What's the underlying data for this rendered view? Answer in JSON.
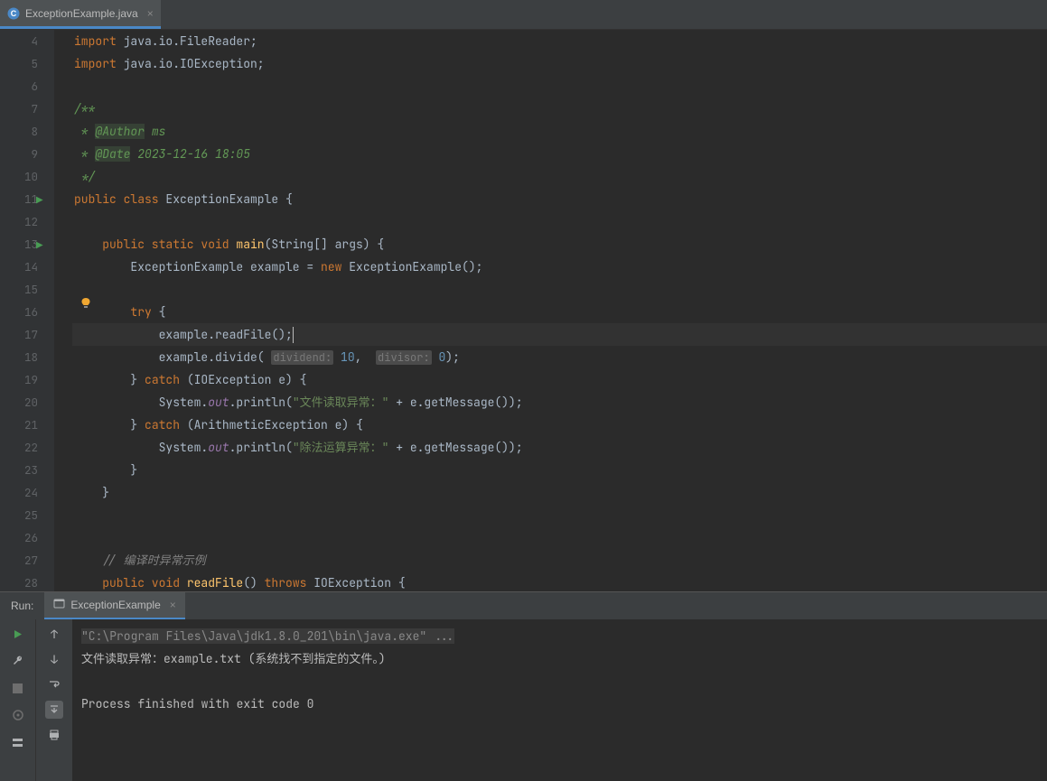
{
  "tab": {
    "filename": "ExceptionExample.java"
  },
  "gutter_start": 4,
  "gutter_end": 28,
  "run_markers": [
    11,
    13
  ],
  "bulb_line": 17,
  "code_lines": [
    {
      "n": 4,
      "html": "<span class='kw'>import </span>java.io.FileReader;"
    },
    {
      "n": 5,
      "html": "<span class='kw'>import </span>java.io.IOException;"
    },
    {
      "n": 6,
      "html": ""
    },
    {
      "n": 7,
      "html": "<span class='doc'>/**</span>"
    },
    {
      "n": 8,
      "html": "<span class='doc'> * </span><span class='anno'>@Author</span><span class='doc'> ms</span>"
    },
    {
      "n": 9,
      "html": "<span class='doc'> * </span><span class='anno'>@Date</span><span class='doc'> 2023-12-16 18:05</span>"
    },
    {
      "n": 10,
      "html": "<span class='doc'> */</span>"
    },
    {
      "n": 11,
      "html": "<span class='kw'>public class </span>ExceptionExample {"
    },
    {
      "n": 12,
      "html": ""
    },
    {
      "n": 13,
      "html": "    <span class='kw'>public static void </span><span class='fn'>main</span>(String[] args) {"
    },
    {
      "n": 14,
      "html": "        ExceptionExample example = <span class='kw'>new </span>ExceptionExample();"
    },
    {
      "n": 15,
      "html": ""
    },
    {
      "n": 16,
      "html": "        <span class='kw'>try </span>{"
    },
    {
      "n": 17,
      "hl": true,
      "html": "            example.readFile();<span class='caret'></span>"
    },
    {
      "n": 18,
      "html": "            example.divide( <span class='param-hint'>dividend:</span> <span class='num'>10</span>,  <span class='param-hint'>divisor:</span> <span class='num'>0</span>);"
    },
    {
      "n": 19,
      "html": "        } <span class='kw'>catch </span>(IOException e) {"
    },
    {
      "n": 20,
      "html": "            System.<span class='field'>out</span>.println(<span class='str'>\"文件读取异常：\"</span> + e.getMessage());"
    },
    {
      "n": 21,
      "html": "        } <span class='kw'>catch </span>(ArithmeticException e) {"
    },
    {
      "n": 22,
      "html": "            System.<span class='field'>out</span>.println(<span class='str'>\"除法运算异常：\"</span> + e.getMessage());"
    },
    {
      "n": 23,
      "html": "        }"
    },
    {
      "n": 24,
      "html": "    }"
    },
    {
      "n": 25,
      "html": ""
    },
    {
      "n": 26,
      "html": ""
    },
    {
      "n": 27,
      "html": "    <span class='comment'>// 编译时异常示例</span>"
    },
    {
      "n": 28,
      "html": "    <span class='kw'>public void </span><span class='fn'>readFile</span>() <span class='kw'>throws </span>IOException {"
    }
  ],
  "run": {
    "label": "Run:",
    "config": "ExceptionExample",
    "console": [
      {
        "cls": "cmd",
        "text": "\"C:\\Program Files\\Java\\jdk1.8.0_201\\bin\\java.exe\" ..."
      },
      {
        "cls": "",
        "text": "文件读取异常：example.txt (系统找不到指定的文件。)"
      },
      {
        "cls": "",
        "text": ""
      },
      {
        "cls": "",
        "text": "Process finished with exit code 0"
      }
    ]
  }
}
